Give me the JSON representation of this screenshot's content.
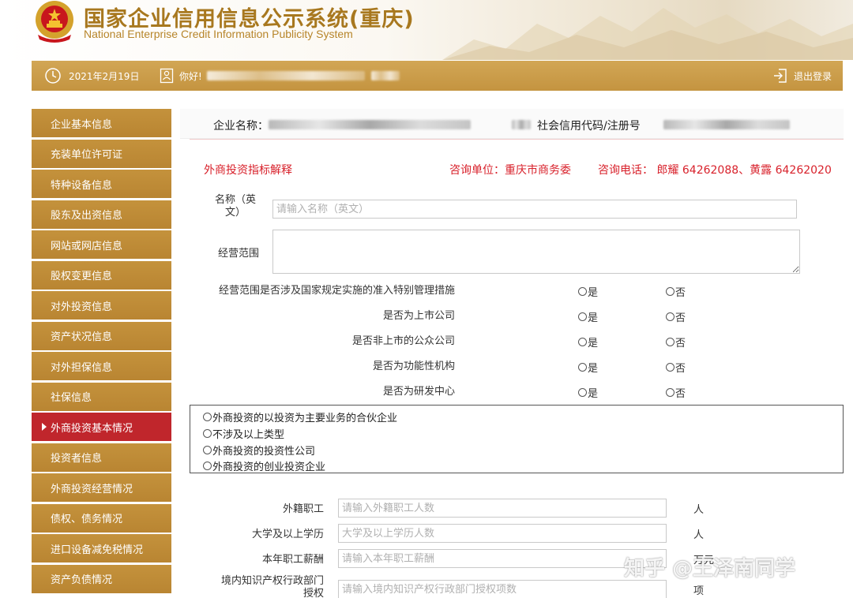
{
  "header": {
    "title_cn": "国家企业信用信息公示系统(重庆)",
    "title_en": "National Enterprise Credit Information Publicity System"
  },
  "topbar": {
    "date": "2021年2月19日",
    "greeting": "你好!",
    "logout": "退出登录"
  },
  "sidebar": {
    "items": [
      {
        "label": "企业基本信息",
        "active": false
      },
      {
        "label": "充装单位许可证",
        "active": false
      },
      {
        "label": "特种设备信息",
        "active": false
      },
      {
        "label": "股东及出资信息",
        "active": false
      },
      {
        "label": "网站或网店信息",
        "active": false
      },
      {
        "label": "股权变更信息",
        "active": false
      },
      {
        "label": "对外投资信息",
        "active": false
      },
      {
        "label": "资产状况信息",
        "active": false
      },
      {
        "label": "对外担保信息",
        "active": false
      },
      {
        "label": "社保信息",
        "active": false
      },
      {
        "label": "外商投资基本情况",
        "active": true
      },
      {
        "label": "投资者信息",
        "active": false
      },
      {
        "label": "外商投资经营情况",
        "active": false
      },
      {
        "label": "债权、债务情况",
        "active": false
      },
      {
        "label": "进口设备减免税情况",
        "active": false
      },
      {
        "label": "资产负债情况",
        "active": false
      }
    ]
  },
  "main": {
    "company_label": "企业名称：",
    "credit_code_label": "社会信用代码/注册号",
    "indicator_link": "外商投资指标解释",
    "consult_unit": "咨询单位：重庆市商务委",
    "consult_phone": "咨询电话：  郎耀 64262088、黄露 64262020",
    "name_en_label": "名称（英文）",
    "name_en_placeholder": "请输入名称（英文）",
    "scope_label": "经营范围",
    "yes": "是",
    "no": "否",
    "questions": [
      "经营范围是否涉及国家规定实施的准入特别管理措施",
      "是否为上市公司",
      "是否非上市的公众公司",
      "是否为功能性机构",
      "是否为研发中心"
    ],
    "types": [
      "外商投资的以投资为主要业务的合伙企业",
      "不涉及以上类型",
      "外商投资的投资性公司",
      "外商投资的创业投资企业"
    ],
    "fields": [
      {
        "label": "外籍职工",
        "placeholder": "请输入外籍职工人数",
        "unit": "人"
      },
      {
        "label": "大学及以上学历",
        "placeholder": "大学及以上学历人数",
        "unit": "人"
      },
      {
        "label": "本年职工薪酬",
        "placeholder": "请输入本年职工薪酬",
        "unit": "万元"
      },
      {
        "label": "境内知识产权行政部门授权",
        "placeholder": "请输入境内知识产权行政部门授权项数",
        "unit": "项"
      }
    ]
  },
  "watermark": "知乎 @王泽南同学"
}
